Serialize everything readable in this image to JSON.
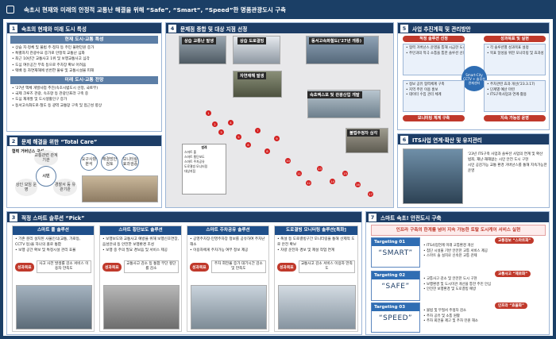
{
  "header": {
    "title": "속초시 현재와 미래의 안정적 교통난 해결을 위해 “Safe”, “Smart”, “Speed”한 명품관광도시 구축"
  },
  "p1": {
    "num": "1",
    "title": "속초의 현재와 미래 도시 특성",
    "sub1": "현재 도시·교통 특성",
    "items1": [
      "상습 지·정체 및 불법 주·정차 등 주민 불편민원 증가",
      "특별자치 관광수요 증가로 안정적 교통난 심화",
      "최근 10년간 교통사고 1위 및 보행교통사고 심각",
      "도심 여유공간 부족 등으로 주차장 확보 어려움",
      "택배 등 자연재해에 빈번한 물류 및 교통시설물 피해"
    ],
    "sub2": "미래 도시·교통 전망",
    "items2": [
      "'27년 액체 개발사업 추진(속초시범도시 선정, 국토부)",
      "국제 크루즈 관광, 속초항 등 관광인프라 구축 중",
      "도심 재개발 및 도시생활인구 증가",
      "동서고속화도로·철도 등 광역 교통망 구축 및 접근성 향상"
    ]
  },
  "p2": {
    "num": "2",
    "title": "문제 해결을 위한 “Total Care”",
    "label": "협력 거버넌스 구성",
    "center": "시민",
    "c1": "교통관련 관계기관",
    "c2": "상인 모임 운영",
    "c3": "경찰서 등 유관기관",
    "right": [
      "요구사항 분석",
      "해결방안 검토",
      "모니터링 효과검증"
    ]
  },
  "p3": {
    "num": "3",
    "title": "적정 스마트 솔루션 “Pick”",
    "solutions": [
      {
        "title": "스마트 폴 솔루션",
        "items": [
          "기존 분리 설치된 사물인식(교통, 가로등, CCTV 등)을 하나의 폴로 통합",
          "보행 공간 확보 및 특정시설 관리 효율"
        ],
        "goal": "사고 사전 발생률 감소 서비스 이용자 만족도"
      },
      {
        "title": "스마트 횡단보도 솔루션",
        "items": [
          "보행보도와 교통사고 예방을 위해 보행신호연장, 음성안내 등 안전한 보행환경 조성",
          "보행 중 주의 필요 경보음 및 서비스 제공"
        ],
        "goal": "교통사고 감소 등 통합 무단 횡단률 감소"
      },
      {
        "title": "스마트 주차공유 솔루션",
        "items": [
          "공영주차장·민영주차장 정보를 공유하여 주차난 해소",
          "이용자에게 주차가능 여부 정보 제공"
        ],
        "goal": "주차 회전율 증가 대기시간 감소 및 만족도"
      },
      {
        "title": "도로결빙 모니터링 솔루션[특화]",
        "items": [
          "폭설 등 도로결빙구간 모니터링을 통해 선제적 도로 안전 확보",
          "차량 운전자 경보 및 제설 작업 연계"
        ],
        "goal": "교통사고 감소 서비스 이용자 만족도"
      }
    ]
  },
  "p4": {
    "num": "4",
    "title": "문제점 종합 및 대상 지점 선정",
    "photos": [
      "상습 교통난 발생",
      "상습 도로결빙",
      "동서고속화철도('27년 개통)",
      "자연재해 발생",
      "속초엑스포 및 관광산업 개발",
      "불법주정차 심각"
    ],
    "legend_title": "범례",
    "legend": [
      "스마트 폴",
      "스마트 횡단보도",
      "스마트 주차공유",
      "도로결빙 모니터링",
      "대상지점"
    ],
    "markers": [
      "1",
      "2",
      "3",
      "4",
      "5",
      "6",
      "7",
      "8",
      "9",
      "10",
      "11",
      "12",
      "13",
      "14",
      "15",
      "16",
      "17"
    ]
  },
  "p5": {
    "num": "5",
    "title": "사업 추진계획 및 관리방안",
    "box1": {
      "title": "적정 솔루션 선정",
      "items": [
        "협력 거버넌스 운영을 통해 시급한 도시문제 파악",
        "주민과의 적극 소통을 통한 솔루션 선정"
      ]
    },
    "box2": {
      "title": "성과목표 및 실현",
      "items": [
        "각 솔루션별 성과목표 설정",
        "목표 달성을 위한 모니터링 및 효과성 검증"
      ]
    },
    "center": "Smart-City CCTV + 솔루션 관제센터",
    "box3": {
      "items": [
        "정보 공유 협력체계 구축",
        "지역 주민 이용 홍보",
        "데이터 수집 관리 체계"
      ]
    },
    "box4": {
      "items": [
        "주차관련 효과 개선('23.3.17)",
        "단계별 예산 마련",
        "ITS구축사업과 연계·활용"
      ]
    },
    "s1": "모니터링 체계 구축",
    "s2": "지속 가능성 운영"
  },
  "p6": {
    "num": "6",
    "title": "ITS사업 연계·확산 및 유지관리",
    "items": [
      "'23년 ITS구축 사업과 솔루션 사업의 연계 및 확산",
      "범죄, 재난·재해없는 시민 안전 도시 구현",
      "시민 공감가능 교통 환경 거버넌스를 통해 지속가능한 운영"
    ]
  },
  "p7": {
    "num": "7",
    "title": "스마트 속초! 안전도시 구축",
    "banner": "인프라 구축의 한계를 넘어 지속 가능한 토탈 도시케어 서비스 실현",
    "targets": [
      {
        "t1": "Targeting 01",
        "t2": "“SMART”",
        "badge": "교통정보 “스마트화”",
        "items": [
          "ITS사업연계 미래 교통환경 개선",
          "첨단 시설물 기반 안전한 교통 서비스 제공",
          "스마트 솔 설치로 신속한 교통 관제"
        ]
      },
      {
        "t1": "Targeting 02",
        "t2": "“SAFE”",
        "badge": "교통사고 “제로화”",
        "items": [
          "교통사고 감소 및 안전한 도시 구현",
          "보행환경 및 도시미관 개선을 통한 주민 안심",
          "안전한 보행환경 및 도로결빙 예방"
        ]
      },
      {
        "t1": "Targeting 03",
        "t2": "“SPEED”",
        "badge": "인프라 “효율화”",
        "items": [
          "불법 및 무질서 주정차 감소",
          "주차 공유 및 소통 원활",
          "주차 회전율 제고 및 주차 민원 해소"
        ]
      }
    ]
  }
}
